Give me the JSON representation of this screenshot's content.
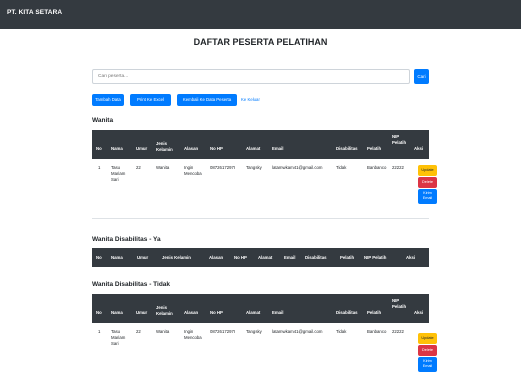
{
  "navbar": {
    "brand": "PT. KITA SETARA"
  },
  "page": {
    "title": "DAFTAR PESERTA PELATIHAN"
  },
  "search": {
    "placeholder": "Cari peserta...",
    "button": "Cari"
  },
  "toolbar": {
    "add_label": "Tambah Data",
    "print_label": "Print Ke Excel",
    "back_label": "Kembali Ke Data Peserta",
    "logout_label": "Ke Keluar"
  },
  "columns": {
    "no": "No",
    "nama": "Nama",
    "umur": "Umur",
    "jk1": "Jenis",
    "jk2": "Kelamin",
    "jk_full": "Jenis Kelamin",
    "alasan": "Alasan",
    "nohp": "No HP",
    "alamat": "Alamat",
    "email": "Email",
    "disabilitas": "Disabilitas",
    "pelatih": "Pelatih",
    "nip1": "NIP",
    "nip2": "Pelatih",
    "nip_full": "NIP Pelatih",
    "aksi": "Aksi"
  },
  "sections": {
    "wanita": "Wanita",
    "dis_ya": "Wanita Disabilitas - Ya",
    "dis_tidak": "Wanita Disabilitas - Tidak"
  },
  "row": {
    "no": "1",
    "nama1": "Tasu",
    "nama2": "Mariam",
    "nama3": "Sari",
    "umur": "22",
    "jk": "Wanita",
    "alasan1": "Ingin",
    "alasan2": "Mencoba",
    "nohp": "0872617297I",
    "alamat": "Tangsky",
    "email": "latamwkam41@gmail.com",
    "disabilitas": "Tidak",
    "pelatih": "Banbanco",
    "nip": "22222"
  },
  "actions": {
    "update": "Update",
    "delete": "Delete",
    "send1": "Kirim",
    "send2": "Email"
  },
  "colors": {
    "navbar": "#343a40",
    "primary": "#007bff",
    "warning": "#ffc107",
    "danger": "#dc3545"
  }
}
